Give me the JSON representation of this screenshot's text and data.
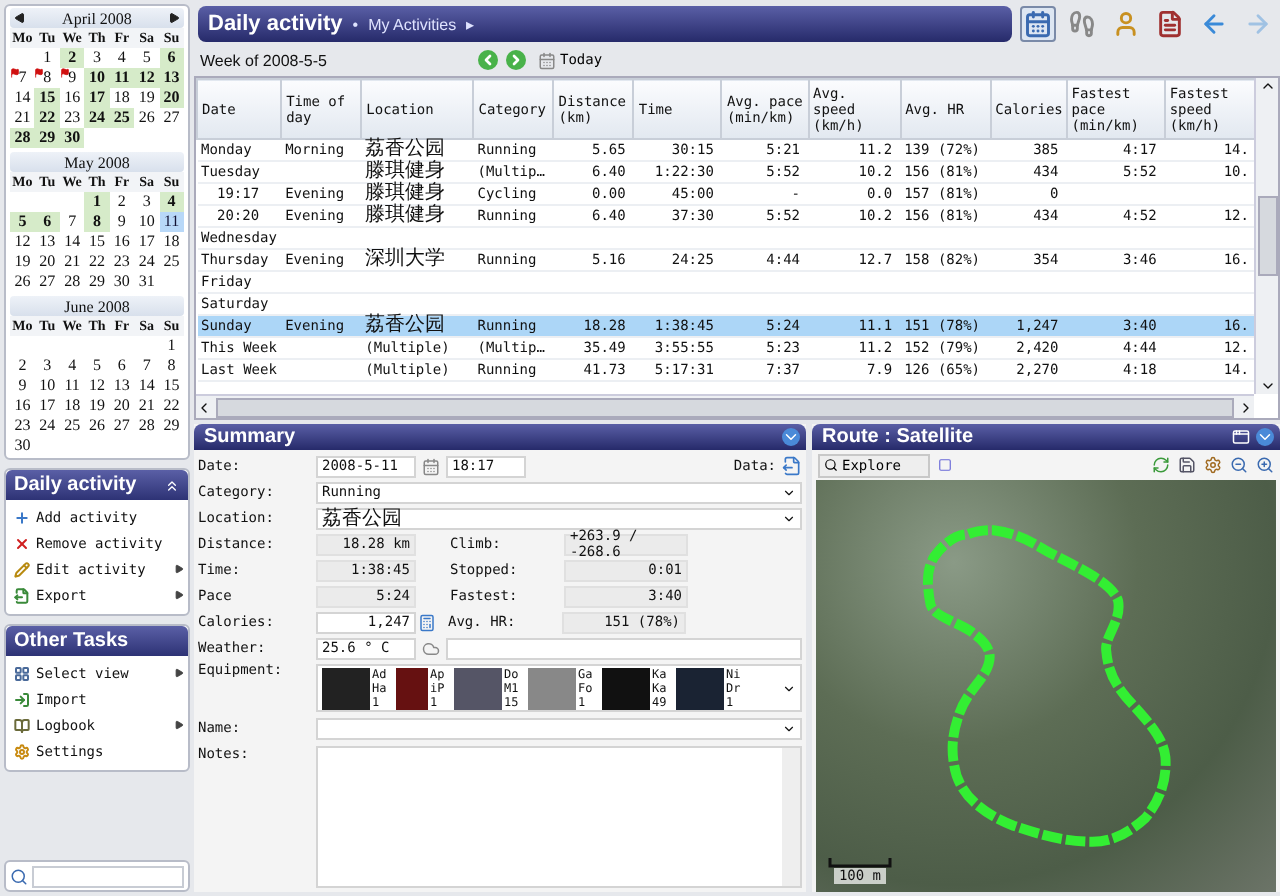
{
  "calendar": {
    "months": [
      {
        "title": "April 2008",
        "nav": true,
        "weekdays": [
          "Mo",
          "Tu",
          "We",
          "Th",
          "Fr",
          "Sa",
          "Su"
        ],
        "days": [
          {
            "kind": "blank"
          },
          {
            "d": "1",
            "kind": "plain",
            "selected": false
          },
          {
            "d": "2",
            "kind": "activity",
            "selected": false
          },
          {
            "d": "3",
            "kind": "plain",
            "selected": false
          },
          {
            "d": "4",
            "kind": "plain",
            "selected": false
          },
          {
            "d": "5",
            "kind": "plain",
            "selected": false
          },
          {
            "d": "6",
            "kind": "activity",
            "selected": false
          },
          {
            "d": "7",
            "kind": "flagged",
            "selected": false
          },
          {
            "d": "8",
            "kind": "flagged",
            "selected": false
          },
          {
            "d": "9",
            "kind": "flagged",
            "selected": false
          },
          {
            "d": "10",
            "kind": "activity",
            "selected": false
          },
          {
            "d": "11",
            "kind": "activity",
            "selected": false
          },
          {
            "d": "12",
            "kind": "activity",
            "selected": false
          },
          {
            "d": "13",
            "kind": "activity",
            "selected": false
          },
          {
            "d": "14",
            "kind": "plain",
            "selected": false
          },
          {
            "d": "15",
            "kind": "activity",
            "selected": false
          },
          {
            "d": "16",
            "kind": "plain",
            "selected": false
          },
          {
            "d": "17",
            "kind": "activity",
            "selected": false
          },
          {
            "d": "18",
            "kind": "plain",
            "selected": false
          },
          {
            "d": "19",
            "kind": "plain",
            "selected": false
          },
          {
            "d": "20",
            "kind": "activity",
            "selected": false
          },
          {
            "d": "21",
            "kind": "plain",
            "selected": false
          },
          {
            "d": "22",
            "kind": "activity",
            "selected": false
          },
          {
            "d": "23",
            "kind": "plain",
            "selected": false
          },
          {
            "d": "24",
            "kind": "activity",
            "selected": false
          },
          {
            "d": "25",
            "kind": "activity",
            "selected": false
          },
          {
            "d": "26",
            "kind": "plain",
            "selected": false
          },
          {
            "d": "27",
            "kind": "plain",
            "selected": false
          },
          {
            "d": "28",
            "kind": "activity",
            "selected": false
          },
          {
            "d": "29",
            "kind": "activity",
            "selected": false
          },
          {
            "d": "30",
            "kind": "activity",
            "selected": false
          }
        ]
      },
      {
        "title": "May 2008",
        "nav": false,
        "weekdays": [
          "Mo",
          "Tu",
          "We",
          "Th",
          "Fr",
          "Sa",
          "Su"
        ],
        "days": [
          {
            "kind": "blank"
          },
          {
            "kind": "blank"
          },
          {
            "kind": "blank"
          },
          {
            "d": "1",
            "kind": "activity",
            "selected": false
          },
          {
            "d": "2",
            "kind": "plain",
            "selected": false
          },
          {
            "d": "3",
            "kind": "plain",
            "selected": false
          },
          {
            "d": "4",
            "kind": "activity",
            "selected": false
          },
          {
            "d": "5",
            "kind": "activity",
            "selected": false
          },
          {
            "d": "6",
            "kind": "activity",
            "selected": false
          },
          {
            "d": "7",
            "kind": "plain",
            "selected": false
          },
          {
            "d": "8",
            "kind": "activity",
            "selected": false
          },
          {
            "d": "9",
            "kind": "plain",
            "selected": false
          },
          {
            "d": "10",
            "kind": "plain",
            "selected": false
          },
          {
            "d": "11",
            "kind": "plain",
            "selected": true
          },
          {
            "d": "12",
            "kind": "plain",
            "selected": false
          },
          {
            "d": "13",
            "kind": "plain",
            "selected": false
          },
          {
            "d": "14",
            "kind": "plain",
            "selected": false
          },
          {
            "d": "15",
            "kind": "plain",
            "selected": false
          },
          {
            "d": "16",
            "kind": "plain",
            "selected": false
          },
          {
            "d": "17",
            "kind": "plain",
            "selected": false
          },
          {
            "d": "18",
            "kind": "plain",
            "selected": false
          },
          {
            "d": "19",
            "kind": "plain",
            "selected": false
          },
          {
            "d": "20",
            "kind": "plain",
            "selected": false
          },
          {
            "d": "21",
            "kind": "plain",
            "selected": false
          },
          {
            "d": "22",
            "kind": "plain",
            "selected": false
          },
          {
            "d": "23",
            "kind": "plain",
            "selected": false
          },
          {
            "d": "24",
            "kind": "plain",
            "selected": false
          },
          {
            "d": "25",
            "kind": "plain",
            "selected": false
          },
          {
            "d": "26",
            "kind": "plain",
            "selected": false
          },
          {
            "d": "27",
            "kind": "plain",
            "selected": false
          },
          {
            "d": "28",
            "kind": "plain",
            "selected": false
          },
          {
            "d": "29",
            "kind": "plain",
            "selected": false
          },
          {
            "d": "30",
            "kind": "plain",
            "selected": false
          },
          {
            "d": "31",
            "kind": "plain",
            "selected": false
          }
        ]
      },
      {
        "title": "June 2008",
        "nav": false,
        "weekdays": [
          "Mo",
          "Tu",
          "We",
          "Th",
          "Fr",
          "Sa",
          "Su"
        ],
        "days": [
          {
            "kind": "blank"
          },
          {
            "kind": "blank"
          },
          {
            "kind": "blank"
          },
          {
            "kind": "blank"
          },
          {
            "kind": "blank"
          },
          {
            "kind": "blank"
          },
          {
            "d": "1",
            "kind": "plain",
            "selected": false
          },
          {
            "d": "2",
            "kind": "plain",
            "selected": false
          },
          {
            "d": "3",
            "kind": "plain",
            "selected": false
          },
          {
            "d": "4",
            "kind": "plain",
            "selected": false
          },
          {
            "d": "5",
            "kind": "plain",
            "selected": false
          },
          {
            "d": "6",
            "kind": "plain",
            "selected": false
          },
          {
            "d": "7",
            "kind": "plain",
            "selected": false
          },
          {
            "d": "8",
            "kind": "plain",
            "selected": false
          },
          {
            "d": "9",
            "kind": "plain",
            "selected": false
          },
          {
            "d": "10",
            "kind": "plain",
            "selected": false
          },
          {
            "d": "11",
            "kind": "plain",
            "selected": false
          },
          {
            "d": "12",
            "kind": "plain",
            "selected": false
          },
          {
            "d": "13",
            "kind": "plain",
            "selected": false
          },
          {
            "d": "14",
            "kind": "plain",
            "selected": false
          },
          {
            "d": "15",
            "kind": "plain",
            "selected": false
          },
          {
            "d": "16",
            "kind": "plain",
            "selected": false
          },
          {
            "d": "17",
            "kind": "plain",
            "selected": false
          },
          {
            "d": "18",
            "kind": "plain",
            "selected": false
          },
          {
            "d": "19",
            "kind": "plain",
            "selected": false
          },
          {
            "d": "20",
            "kind": "plain",
            "selected": false
          },
          {
            "d": "21",
            "kind": "plain",
            "selected": false
          },
          {
            "d": "22",
            "kind": "plain",
            "selected": false
          },
          {
            "d": "23",
            "kind": "plain",
            "selected": false
          },
          {
            "d": "24",
            "kind": "plain",
            "selected": false
          },
          {
            "d": "25",
            "kind": "plain",
            "selected": false
          },
          {
            "d": "26",
            "kind": "plain",
            "selected": false
          },
          {
            "d": "27",
            "kind": "plain",
            "selected": false
          },
          {
            "d": "28",
            "kind": "plain",
            "selected": false
          },
          {
            "d": "29",
            "kind": "plain",
            "selected": false
          },
          {
            "d": "30",
            "kind": "plain",
            "selected": false
          }
        ]
      }
    ]
  },
  "sidebar": {
    "panels": [
      {
        "title": "Daily activity",
        "items": [
          {
            "label": "Add activity",
            "kind": "add",
            "submenu": false
          },
          {
            "label": "Remove activity",
            "kind": "remove",
            "submenu": false
          },
          {
            "label": "Edit activity",
            "kind": "edit",
            "submenu": true
          },
          {
            "label": "Export",
            "kind": "export",
            "submenu": true
          }
        ]
      },
      {
        "title": "Other Tasks",
        "items": [
          {
            "label": "Select view",
            "kind": "view",
            "submenu": true
          },
          {
            "label": "Import",
            "kind": "import",
            "submenu": false
          },
          {
            "label": "Logbook",
            "kind": "logbook",
            "submenu": true
          },
          {
            "label": "Settings",
            "kind": "settings",
            "submenu": false
          }
        ]
      }
    ]
  },
  "header": {
    "title": "Daily activity",
    "separator": "•",
    "breadcrumb": "My Activities",
    "crumb_arrow": "▸",
    "tools": [
      {
        "kind": "calendar",
        "selected": true,
        "disabled": false
      },
      {
        "kind": "shoe",
        "selected": false,
        "disabled": false
      },
      {
        "kind": "person",
        "selected": false,
        "disabled": false
      },
      {
        "kind": "document",
        "selected": false,
        "disabled": false
      },
      {
        "kind": "back",
        "selected": false,
        "disabled": false
      },
      {
        "kind": "forward",
        "selected": false,
        "disabled": true
      }
    ]
  },
  "week_bar": {
    "label": "Week of 2008-5-5",
    "today": "Today"
  },
  "table": {
    "columns": [
      {
        "label": "Date"
      },
      {
        "label": "Time of day"
      },
      {
        "label": "Location"
      },
      {
        "label": "Category"
      },
      {
        "label": "Distance (km)"
      },
      {
        "label": "Time"
      },
      {
        "label": "Avg. pace (min/km)"
      },
      {
        "label": "Avg. speed (km/h)"
      },
      {
        "label": "Avg. HR"
      },
      {
        "label": "Calories"
      },
      {
        "label": "Fastest pace (min/km)"
      },
      {
        "label": "Fastest speed (km/h)"
      }
    ],
    "rows": [
      {
        "selected": false,
        "cells": [
          "Monday",
          "Morning",
          "荔香公园",
          "Running",
          "5.65",
          "30:15",
          "5:21",
          "11.2",
          "139 (72%)",
          "385",
          "4:17",
          "14."
        ]
      },
      {
        "selected": false,
        "cells": [
          "Tuesday",
          null,
          "滕琪健身",
          "(Multip…",
          "6.40",
          "1:22:30",
          "5:52",
          "10.2",
          "156 (81%)",
          "434",
          "5:52",
          "10."
        ],
        "children": [
          {
            "selected": false,
            "cells": [
              "19:17",
              "Evening",
              "滕琪健身",
              "Cycling",
              "0.00",
              "45:00",
              "-",
              "0.0",
              "157 (81%)",
              "0",
              null,
              null
            ]
          },
          {
            "selected": false,
            "cells": [
              "20:20",
              "Evening",
              "滕琪健身",
              "Running",
              "6.40",
              "37:30",
              "5:52",
              "10.2",
              "156 (81%)",
              "434",
              "4:52",
              "12."
            ]
          }
        ]
      },
      {
        "selected": false,
        "cells": [
          "Wednesday"
        ]
      },
      {
        "selected": false,
        "cells": [
          "Thursday",
          "Evening",
          "深圳大学",
          "Running",
          "5.16",
          "24:25",
          "4:44",
          "12.7",
          "158 (82%)",
          "354",
          "3:46",
          "16."
        ]
      },
      {
        "selected": false,
        "cells": [
          "Friday"
        ]
      },
      {
        "selected": false,
        "cells": [
          "Saturday"
        ]
      },
      {
        "selected": true,
        "cells": [
          "Sunday",
          "Evening",
          "荔香公园",
          "Running",
          "18.28",
          "1:38:45",
          "5:24",
          "11.1",
          "151 (78%)",
          "1,247",
          "3:40",
          "16."
        ]
      },
      {
        "selected": false,
        "cells": [
          "This Week",
          null,
          "(Multiple)",
          "(Multip…",
          "35.49",
          "3:55:55",
          "5:23",
          "11.2",
          "152 (79%)",
          "2,420",
          "4:44",
          "12."
        ]
      },
      {
        "selected": false,
        "cells": [
          "Last Week",
          null,
          "(Multiple)",
          "Running",
          "41.73",
          "5:17:31",
          "7:37",
          "7.9",
          "126 (65%)",
          "2,270",
          "4:18",
          "14."
        ]
      }
    ]
  },
  "summary": {
    "title": "Summary",
    "date": {
      "label": "Date:",
      "value": "2008-5-11",
      "time": "18:17"
    },
    "data_label": "Data:",
    "category": {
      "label": "Category:",
      "value": "Running"
    },
    "location": {
      "label": "Location:",
      "value": "荔香公园"
    },
    "stats": [
      {
        "label": "Distance:",
        "value": "18.28 km",
        "editable": false,
        "label2": "Climb:",
        "value2": "+263.9 / -268.6"
      },
      {
        "label": "Time:",
        "value": "1:38:45",
        "editable": false,
        "label2": "Stopped:",
        "value2": "0:01"
      },
      {
        "label": "Pace",
        "value": "5:24",
        "editable": false,
        "label2": "Fastest:",
        "value2": "3:40"
      },
      {
        "label": "Calories:",
        "value": "1,247",
        "editable": true,
        "label2": "Avg. HR:",
        "value2": "151 (78%)"
      }
    ],
    "weather": {
      "label": "Weather:",
      "value": "25.6 ° C"
    },
    "equipment": {
      "label": "Equipment:",
      "items": [
        {
          "kind": "band",
          "lines": [
            "Ad",
            "Ha",
            "1"
          ]
        },
        {
          "kind": "player",
          "lines": [
            "Ap",
            "iP",
            "1"
          ]
        },
        {
          "kind": "shoe",
          "lines": [
            "Do",
            "M1",
            "15"
          ]
        },
        {
          "kind": "watch",
          "lines": [
            "Ga",
            "Fo",
            "1"
          ]
        },
        {
          "kind": "shorts",
          "lines": [
            "Ka",
            "Ka",
            "49"
          ]
        },
        {
          "kind": "shirt",
          "lines": [
            "Ni",
            "Dr",
            "1"
          ]
        }
      ]
    },
    "name": {
      "label": "Name:"
    },
    "notes": {
      "label": "Notes:"
    }
  },
  "route": {
    "title": "Route : Satellite",
    "explore": "Explore",
    "scale": "100 m"
  }
}
